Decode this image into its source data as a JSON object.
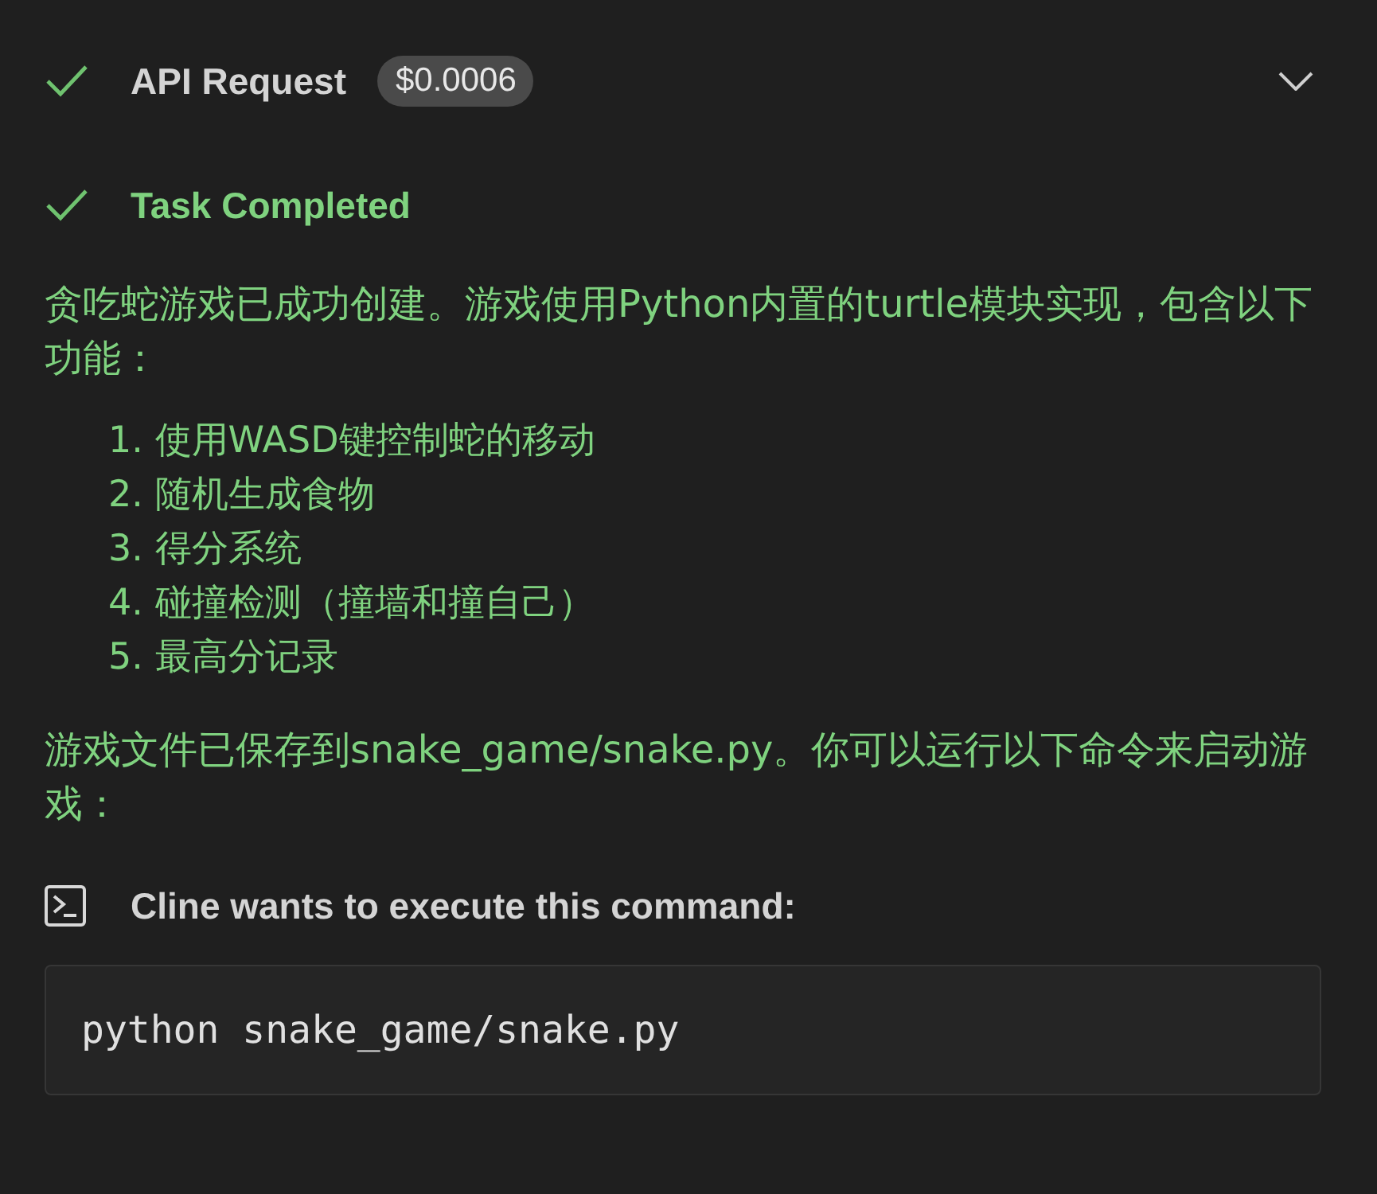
{
  "api_request": {
    "title": "API Request",
    "cost": "$0.0006"
  },
  "task": {
    "title": "Task Completed"
  },
  "message": {
    "intro": "贪吃蛇游戏已成功创建。游戏使用Python内置的turtle模块实现，包含以下功能：",
    "features": [
      "1. 使用WASD键控制蛇的移动",
      "2. 随机生成食物",
      "3. 得分系统",
      "4. 碰撞检测（撞墙和撞自己）",
      "5. 最高分记录"
    ],
    "outro": "游戏文件已保存到snake_game/snake.py。你可以运行以下命令来启动游戏："
  },
  "command": {
    "title": "Cline wants to execute this command:",
    "code": "python snake_game/snake.py"
  }
}
